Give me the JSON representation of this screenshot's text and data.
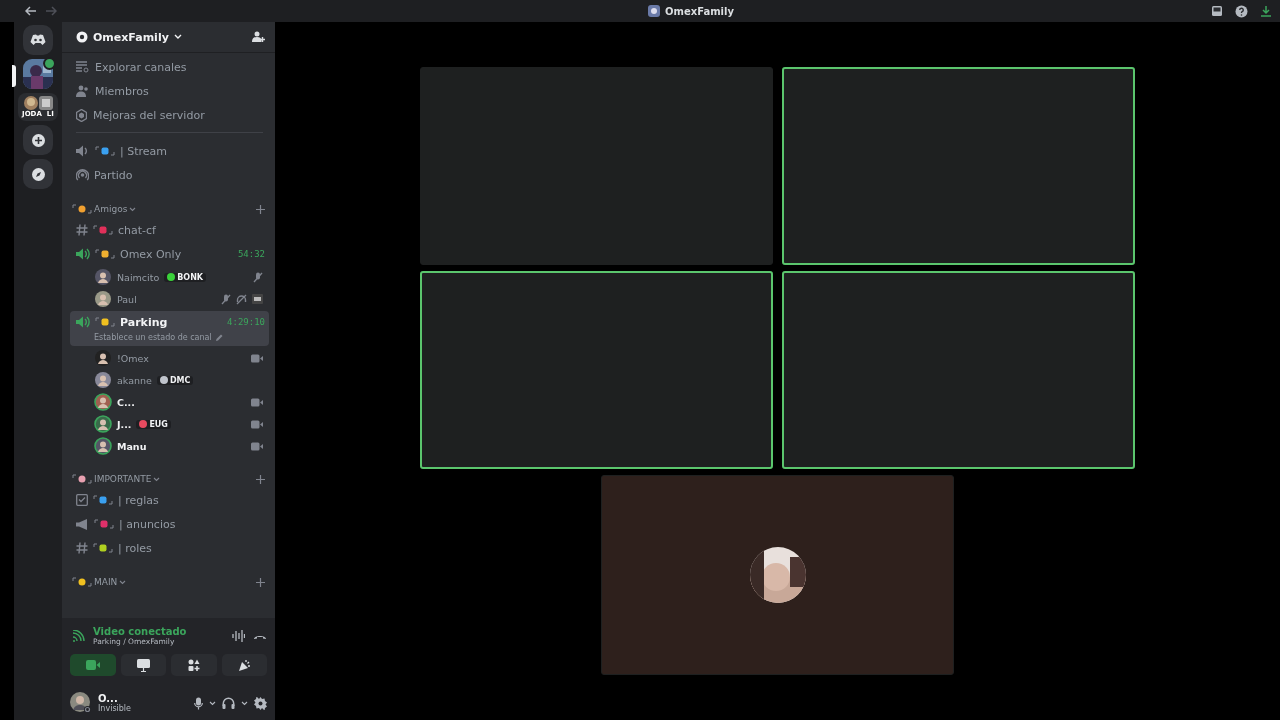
{
  "window": {
    "title": "OmexFamily"
  },
  "servers": [
    {
      "kind": "home",
      "selected": false
    },
    {
      "kind": "server",
      "selected": true,
      "unread": true
    },
    {
      "kind": "folder",
      "selected": false,
      "labels": [
        "JODA",
        "LI"
      ]
    },
    {
      "kind": "add",
      "selected": false
    },
    {
      "kind": "discover",
      "selected": false
    }
  ],
  "server_header": {
    "name": "OmexFamily"
  },
  "nav": [
    {
      "kind": "browse",
      "label": "Explorar canales"
    },
    {
      "kind": "members",
      "label": "Miembros"
    },
    {
      "kind": "boost",
      "label": "Mejoras del servidor"
    }
  ],
  "channels": [
    {
      "kind": "stage",
      "name": "| Stream",
      "color": "#3aa0f0",
      "selected": false
    },
    {
      "kind": "forum",
      "name": "Partido",
      "selected": false
    },
    {
      "kind": "category",
      "name": "Amigos",
      "color": "#f0a030"
    },
    {
      "kind": "text",
      "name": "chat-cf",
      "color": "#e0305a",
      "selected": false
    },
    {
      "kind": "voice",
      "name": "Omex Only",
      "color": "#f0b030",
      "timer": "54:32",
      "selected": false
    },
    {
      "kind": "user",
      "name": "Naimcito",
      "tag": "BONK",
      "color": "#3ad13a",
      "speaking": false,
      "muted": true
    },
    {
      "kind": "user",
      "name": "Paul",
      "speaking": false,
      "muted": true,
      "deafened": true,
      "extra": true
    },
    {
      "kind": "voice",
      "name": "Parking",
      "color": "#f0c020",
      "timer": "4:29:10",
      "status": "Establece un estado de canal",
      "selected": true
    },
    {
      "kind": "user",
      "name": "!Omex",
      "speaking": false,
      "video": true
    },
    {
      "kind": "user",
      "name": "akanne",
      "tag": "DMC",
      "color": "#c0c4cc",
      "speaking": false
    },
    {
      "kind": "user",
      "name": "C...",
      "speaking": true,
      "video": true
    },
    {
      "kind": "user",
      "name": "J...",
      "tag": "EUG",
      "color": "#e84a5f",
      "speaking": true,
      "video": true
    },
    {
      "kind": "user",
      "name": "Manu",
      "speaking": true,
      "video": true
    },
    {
      "kind": "category",
      "name": "IMPORTANTE",
      "color": "#e8a0b0"
    },
    {
      "kind": "rules",
      "name": "| reglas",
      "color": "#3aa0f0",
      "selected": false
    },
    {
      "kind": "announce",
      "name": "| anuncios",
      "color": "#e0306a",
      "selected": false
    },
    {
      "kind": "text",
      "name": "| roles",
      "color": "#b0d020",
      "selected": false
    },
    {
      "kind": "category",
      "name": "MAIN",
      "color": "#f0c020"
    }
  ],
  "voice_panel": {
    "status": "Video conectado",
    "location": "Parking / OmexFamily",
    "buttons": [
      {
        "kind": "camera",
        "on": true
      },
      {
        "kind": "screen",
        "on": false
      },
      {
        "kind": "activities",
        "on": false
      },
      {
        "kind": "soundboard",
        "on": false
      }
    ]
  },
  "user_panel": {
    "name": "O...",
    "status": "Invisible"
  },
  "tiles": [
    {
      "speaking": false,
      "kind": "empty"
    },
    {
      "speaking": true,
      "kind": "empty"
    },
    {
      "speaking": true,
      "kind": "empty"
    },
    {
      "speaking": true,
      "kind": "empty"
    },
    {
      "speaking": false,
      "kind": "avatar"
    }
  ]
}
